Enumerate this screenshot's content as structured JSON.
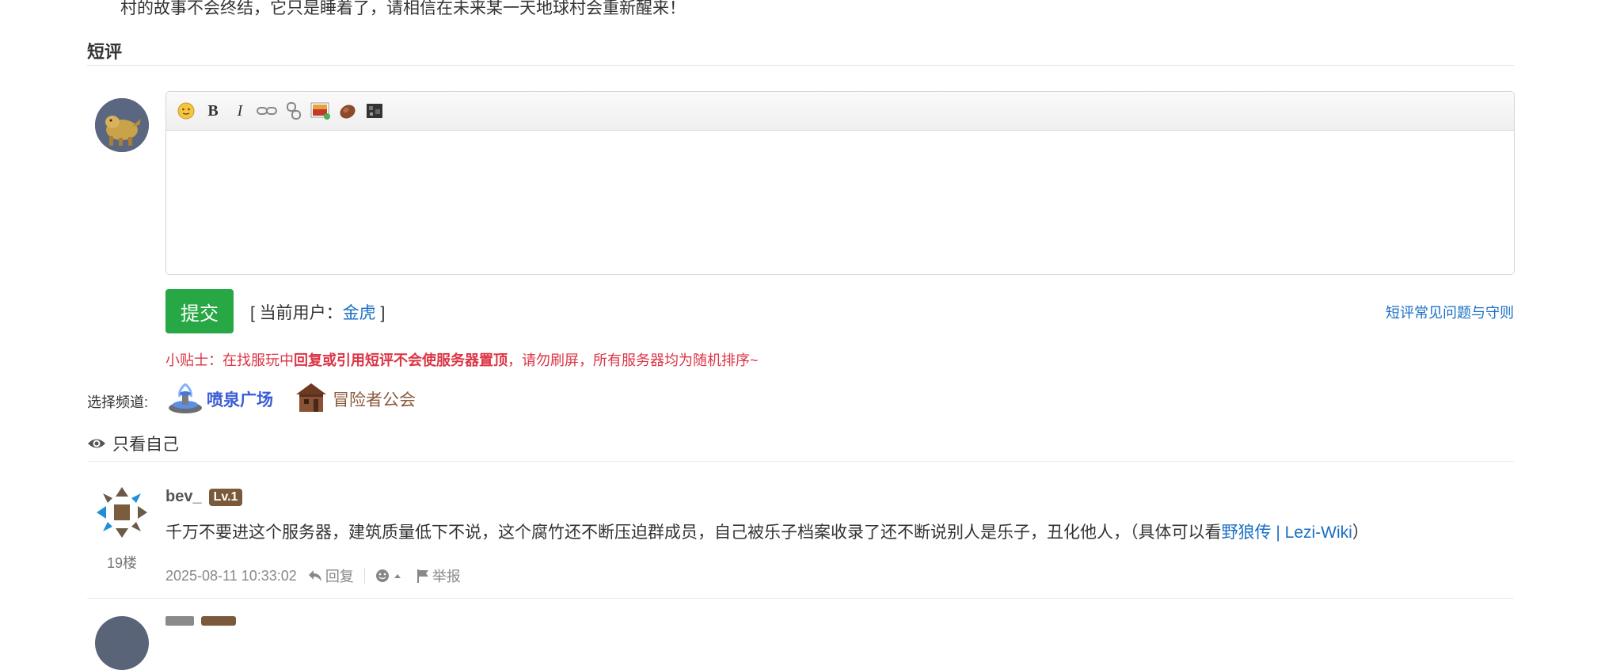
{
  "intro": {
    "text": "村的故事不会终结，它只是睡着了，请相信在未来某一天地球村会重新醒来！"
  },
  "section": {
    "title": "短评"
  },
  "editor": {
    "toolbar": [
      {
        "name": "emoji-icon",
        "glyph": "☺"
      },
      {
        "name": "bold-icon",
        "glyph": "B"
      },
      {
        "name": "italic-icon",
        "glyph": "I"
      },
      {
        "name": "link-icon",
        "glyph": ""
      },
      {
        "name": "unlink-icon",
        "glyph": ""
      },
      {
        "name": "image-icon",
        "glyph": ""
      },
      {
        "name": "item-icon",
        "glyph": ""
      },
      {
        "name": "block-icon",
        "glyph": ""
      }
    ]
  },
  "actions": {
    "submit_label": "提交",
    "current_user_prefix": "[ 当前用户：",
    "current_user_name": "金虎",
    "current_user_suffix": " ]",
    "faq_link": "短评常见问题与守则"
  },
  "tip": {
    "prefix": "小贴士：在找服玩中",
    "bold": "回复或引用短评不会使服务器置顶",
    "suffix": "，请勿刷屏，所有服务器均为随机排序~"
  },
  "channels": {
    "label": "选择频道:",
    "items": [
      {
        "label": "喷泉广场"
      },
      {
        "label": "冒险者公会"
      }
    ]
  },
  "filter": {
    "only_me": "只看自己"
  },
  "comments": [
    {
      "user": "bev_",
      "level": "Lv.1",
      "floor": "19楼",
      "text": "千万不要进这个服务器，建筑质量低下不说，这个腐竹还不断压迫群成员，自己被乐子档案收录了还不断说别人是乐子，丑化他人，（具体可以看",
      "link_text": "野狼传 | Lezi-Wiki",
      "text_end": "）",
      "time": "2025-08-11 10:33:02",
      "reply_label": "回复",
      "report_label": "举报"
    }
  ],
  "colors": {
    "accent_green": "#28a745",
    "link_blue": "#1a6fc4",
    "tip_red": "#dc3545",
    "fountain_blue": "#3b5bd6",
    "guild_brown": "#8a5a3c",
    "level_badge": "#7b5a3b"
  }
}
